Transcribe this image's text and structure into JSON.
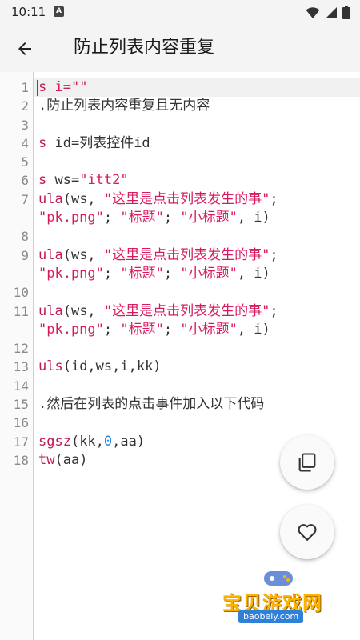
{
  "status_bar": {
    "time": "10:11",
    "notif_letter": "A"
  },
  "app_bar": {
    "title": "防止列表内容重复"
  },
  "editor": {
    "line_numbers": [
      "1",
      "2",
      "3",
      "4",
      "5",
      "6",
      "7",
      "",
      "8",
      "9",
      "",
      "10",
      "11",
      "",
      "12",
      "13",
      "14",
      "15",
      "16",
      "17",
      "18"
    ],
    "lines": [
      [
        {
          "t": "s",
          "c": "kw"
        },
        {
          "t": " i=\"\"",
          "c": "str"
        }
      ],
      [
        {
          "t": ".防止列表内容重复且无内容",
          "c": "text"
        }
      ],
      [],
      [
        {
          "t": "s",
          "c": "kw"
        },
        {
          "t": " id=列表控件id",
          "c": "text"
        }
      ],
      [],
      [
        {
          "t": "s",
          "c": "kw"
        },
        {
          "t": " ws=",
          "c": "text"
        },
        {
          "t": "\"itt2\"",
          "c": "str"
        }
      ],
      [
        {
          "t": "ula",
          "c": "kw"
        },
        {
          "t": "(ws, ",
          "c": "text"
        },
        {
          "t": "\"这里是点击列表发生的事\"",
          "c": "str"
        },
        {
          "t": ";",
          "c": "text"
        }
      ],
      [
        {
          "t": "\"pk.png\"",
          "c": "str"
        },
        {
          "t": "; ",
          "c": "text"
        },
        {
          "t": "\"标题\"",
          "c": "str"
        },
        {
          "t": "; ",
          "c": "text"
        },
        {
          "t": "\"小标题\"",
          "c": "str"
        },
        {
          "t": ", i)",
          "c": "text"
        }
      ],
      [],
      [
        {
          "t": "ula",
          "c": "kw"
        },
        {
          "t": "(ws, ",
          "c": "text"
        },
        {
          "t": "\"这里是点击列表发生的事\"",
          "c": "str"
        },
        {
          "t": ";",
          "c": "text"
        }
      ],
      [
        {
          "t": "\"pk.png\"",
          "c": "str"
        },
        {
          "t": "; ",
          "c": "text"
        },
        {
          "t": "\"标题\"",
          "c": "str"
        },
        {
          "t": "; ",
          "c": "text"
        },
        {
          "t": "\"小标题\"",
          "c": "str"
        },
        {
          "t": ", i)",
          "c": "text"
        }
      ],
      [],
      [
        {
          "t": "ula",
          "c": "kw"
        },
        {
          "t": "(ws, ",
          "c": "text"
        },
        {
          "t": "\"这里是点击列表发生的事\"",
          "c": "str"
        },
        {
          "t": ";",
          "c": "text"
        }
      ],
      [
        {
          "t": "\"pk.png\"",
          "c": "str"
        },
        {
          "t": "; ",
          "c": "text"
        },
        {
          "t": "\"标题\"",
          "c": "str"
        },
        {
          "t": "; ",
          "c": "text"
        },
        {
          "t": "\"小标题\"",
          "c": "str"
        },
        {
          "t": ", i)",
          "c": "text"
        }
      ],
      [],
      [
        {
          "t": "uls",
          "c": "kw"
        },
        {
          "t": "(id,ws,i,kk)",
          "c": "text"
        }
      ],
      [],
      [
        {
          "t": ".然后在列表的点击事件加入以下代码",
          "c": "text"
        }
      ],
      [],
      [
        {
          "t": "sgsz",
          "c": "kw"
        },
        {
          "t": "(kk,",
          "c": "text"
        },
        {
          "t": "0",
          "c": "num"
        },
        {
          "t": ",aa)",
          "c": "text"
        }
      ],
      [
        {
          "t": "tw",
          "c": "kw"
        },
        {
          "t": "(aa)",
          "c": "text"
        }
      ]
    ]
  },
  "fabs": {
    "copy_icon": "copy-icon",
    "like_icon": "heart-icon"
  },
  "watermark": {
    "text": "宝贝游戏网",
    "url": "baobeiy.com"
  },
  "colors": {
    "keyword": "#c2185b",
    "string": "#d81b60",
    "number": "#1e88e5",
    "text": "#333333"
  }
}
